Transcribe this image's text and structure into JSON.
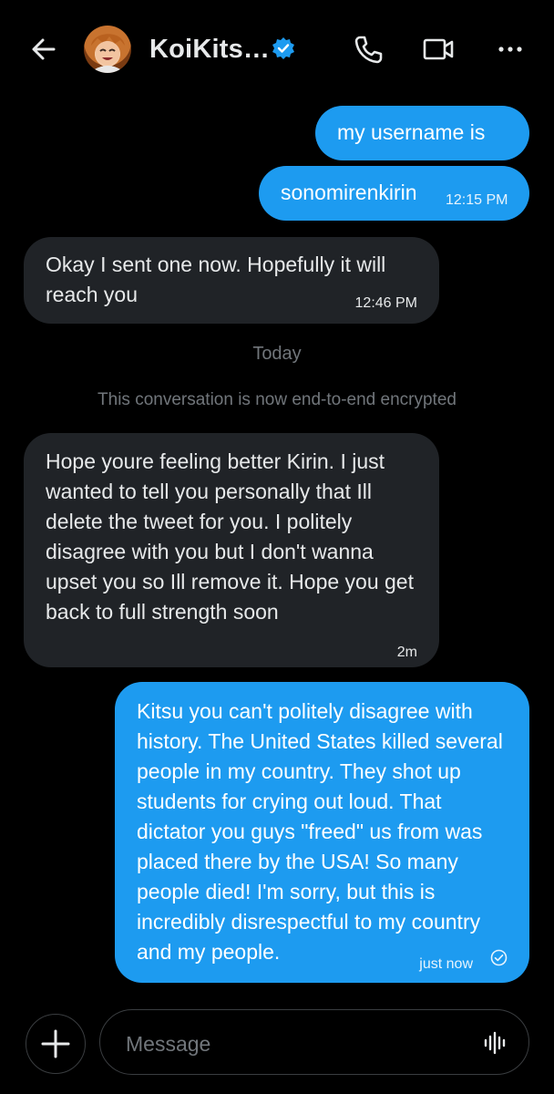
{
  "header": {
    "back_icon": "arrow-left-icon",
    "contact_name": "KoiKits…",
    "verified_color": "#1d9bf0",
    "call_icon": "phone-icon",
    "video_icon": "video-camera-icon",
    "more_icon": "ellipsis-icon"
  },
  "messages": [
    {
      "direction": "outgoing",
      "text": "my username is",
      "time": ""
    },
    {
      "direction": "outgoing",
      "text": "sonomirenkirin",
      "time": "12:15 PM"
    },
    {
      "direction": "incoming",
      "text": "Okay I sent one now.  Hopefully it will reach you",
      "time": "12:46 PM"
    },
    {
      "direction": "incoming",
      "text": "Hope youre feeling better Kirin.  I just wanted to tell you personally that Ill delete the tweet for you.  I politely disagree with you but I don't wanna upset you so Ill remove it.  Hope you get back to full strength soon",
      "time": "2m"
    },
    {
      "direction": "outgoing",
      "text": "Kitsu you can't politely disagree with history. The United States killed several people in my country. They shot up students for crying out loud. That dictator you guys \"freed\" us from was placed there by the USA! So many people died! I'm sorry, but this is incredibly disrespectful to my country and my people.",
      "time": "just now",
      "status_icon": "seen-check-icon"
    }
  ],
  "divider": {
    "day": "Today",
    "encryption_notice": "This conversation is now end-to-end encrypted"
  },
  "composer": {
    "add_icon": "plus-icon",
    "placeholder": "Message",
    "voice_icon": "voice-waveform-icon"
  },
  "colors": {
    "background": "#000000",
    "outgoing_bubble": "#1d9bf0",
    "incoming_bubble": "#202327",
    "muted_text": "#71767b"
  }
}
